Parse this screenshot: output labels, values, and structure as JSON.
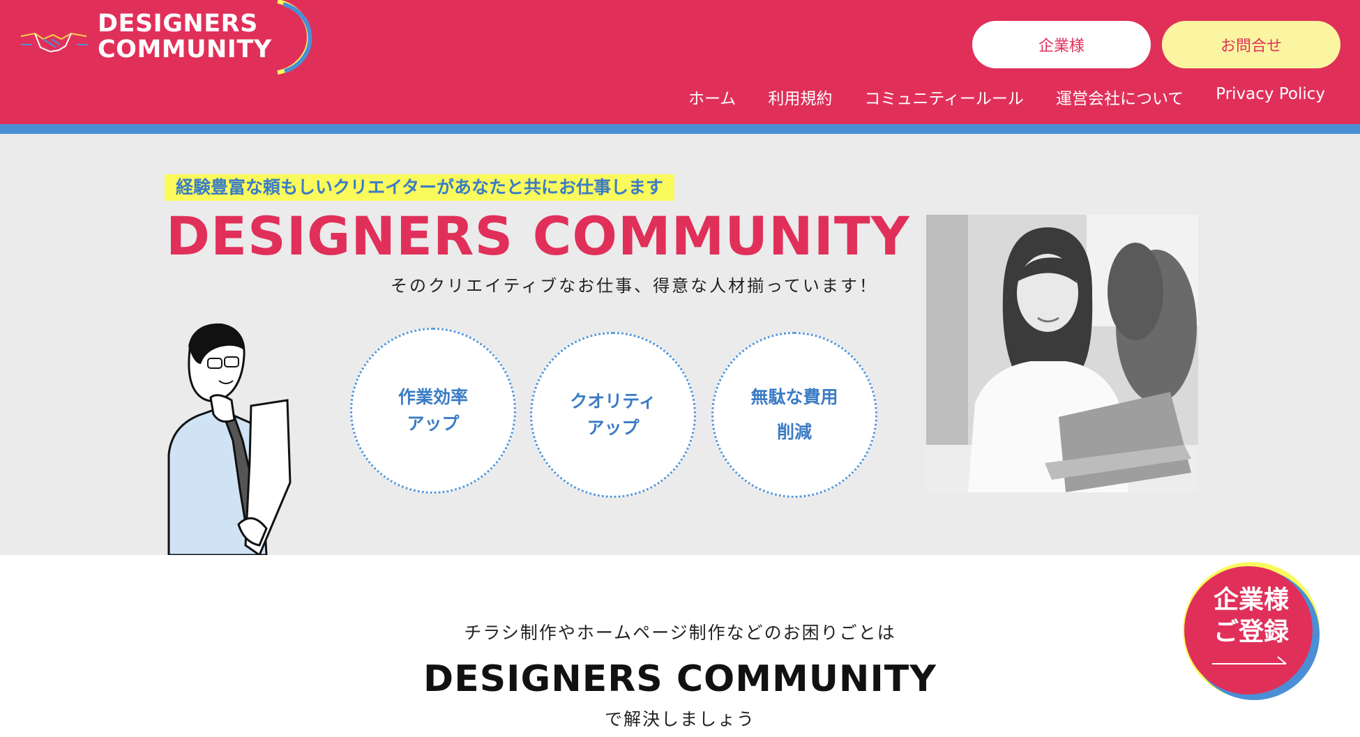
{
  "header": {
    "logo_line1": "DESIGNERS",
    "logo_line2": "COMMUNITY",
    "company_button": "企業様",
    "contact_button": "お問合せ",
    "nav": [
      "ホーム",
      "利用規約",
      "コミュニティールール",
      "運営会社について",
      "Privacy Policy"
    ]
  },
  "hero": {
    "tagline": "経験豊富な頼もしいクリエイターがあなたと共にお仕事します",
    "title": "DESIGNERS COMMUNITY",
    "subtitle": "そのクリエイティブなお仕事、得意な人材揃っています！",
    "circles": [
      {
        "line1": "作業効率",
        "line2": "アップ"
      },
      {
        "line1": "クオリティ",
        "line2": "アップ"
      },
      {
        "line1": "無駄な費用",
        "line2": "削減"
      }
    ]
  },
  "lower": {
    "subtitle": "チラシ制作やホームページ制作などのお困りごとは",
    "title": "DESIGNERS COMMUNITY",
    "subtitle2": "で解決しましょう"
  },
  "register_badge": {
    "line1": "企業様",
    "line2": "ご登録"
  },
  "colors": {
    "brand_pink": "#e0305a",
    "accent_blue": "#4a8fd6",
    "accent_yellow": "#fafa5c",
    "hero_bg": "#ebebeb"
  },
  "icons": {
    "logo": "handshake-icon",
    "register_arrow": "arrow-right-icon"
  }
}
